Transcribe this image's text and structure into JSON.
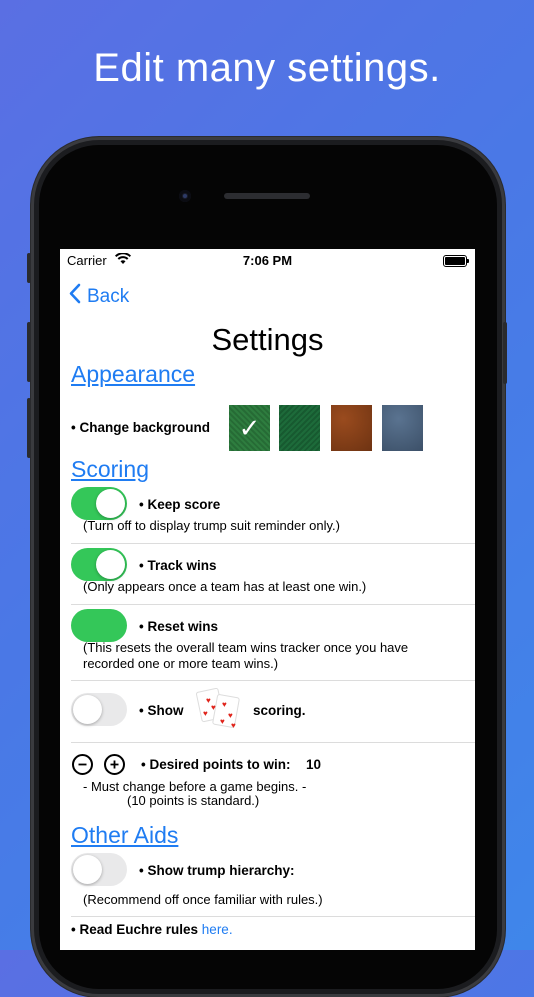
{
  "headline": "Edit many settings.",
  "status_bar": {
    "carrier": "Carrier",
    "time": "7:06 PM"
  },
  "nav": {
    "back_label": "Back"
  },
  "page_title": "Settings",
  "appearance": {
    "heading": "Appearance",
    "change_background_label": "• Change background",
    "backgrounds": [
      "green-felt",
      "green-diagonal",
      "brown-leather",
      "blue-slate"
    ],
    "selected_background": 0,
    "checkmark": "✓"
  },
  "scoring": {
    "heading": "Scoring",
    "keep_score": {
      "label": "• Keep score",
      "note": "(Turn off to display trump suit reminder only.)",
      "on": true
    },
    "track_wins": {
      "label": "• Track wins",
      "note": "(Only appears once a team has at least one win.)",
      "on": true
    },
    "reset_wins": {
      "label": "• Reset wins",
      "note": "(This resets the overall team wins tracker once you have recorded one or more team wins.)"
    },
    "show_scoring": {
      "label_before": "• Show",
      "label_after": "scoring.",
      "on": false
    },
    "desired_points": {
      "label": "• Desired points to win:",
      "value": "10",
      "note_line1": "- Must change before a game begins. -",
      "note_line2": "(10 points is standard.)"
    }
  },
  "other_aids": {
    "heading": "Other Aids",
    "trump_hierarchy": {
      "label": "• Show trump hierarchy:",
      "note": "(Recommend off once familiar with rules.)",
      "on": false
    },
    "read_rules": {
      "label": "• Read Euchre rules",
      "link": "here."
    }
  }
}
